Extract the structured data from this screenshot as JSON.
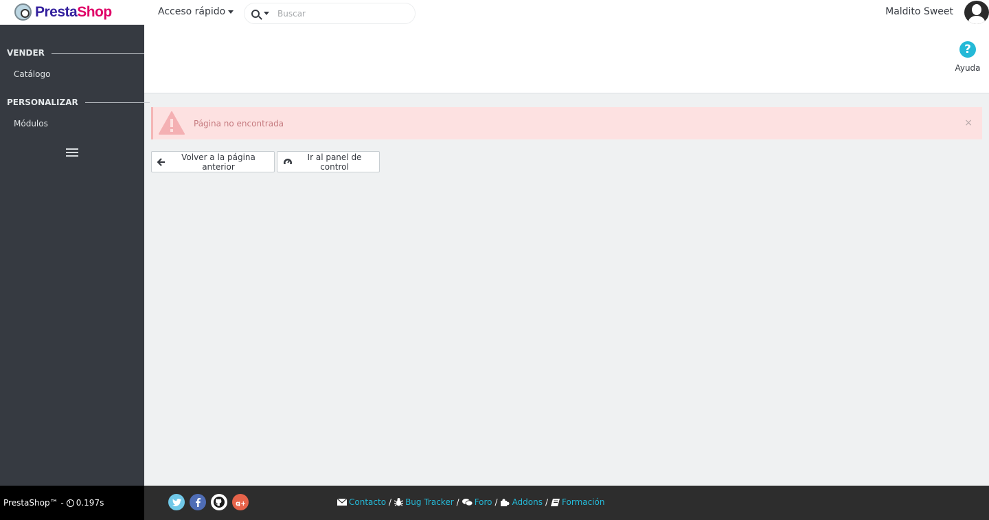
{
  "header": {
    "logo_text_1": "Presta",
    "logo_text_2": "Shop",
    "quick_access_label": "Acceso rápido",
    "search_placeholder": "Buscar",
    "user_name": "Maldito Sweet"
  },
  "sidebar": {
    "sections": [
      {
        "title": "VENDER",
        "items": [
          {
            "label": "Catálogo"
          }
        ]
      },
      {
        "title": "PERSONALIZAR",
        "items": [
          {
            "label": "Módulos"
          }
        ]
      }
    ]
  },
  "toolbar": {
    "help_label": "Ayuda",
    "help_glyph": "?"
  },
  "alert": {
    "message": "Página no encontrada",
    "close_glyph": "×"
  },
  "actions": {
    "back_label": "Volver a la página anterior",
    "dashboard_label": "Ir al panel de control"
  },
  "footer": {
    "brand": "PrestaShop™ -",
    "load_time": "0.197s",
    "social": [
      {
        "name": "twitter-icon",
        "glyph": "t",
        "color": "#70c8e8"
      },
      {
        "name": "facebook-icon",
        "glyph": "f",
        "color": "#4f6db6"
      },
      {
        "name": "github-icon",
        "glyph": "◉",
        "color": "#ffffff"
      },
      {
        "name": "google-plus-icon",
        "glyph": "g+",
        "color": "#e6634a"
      }
    ],
    "links": {
      "contact": "Contacto",
      "bug_tracker": "Bug Tracker",
      "forum": "Foro",
      "addons": "Addons",
      "training": "Formación"
    },
    "separator": "/"
  },
  "colors": {
    "accent": "#25b9d7",
    "sidebar_bg": "#363a41",
    "alert_bg": "#fde1e1"
  }
}
